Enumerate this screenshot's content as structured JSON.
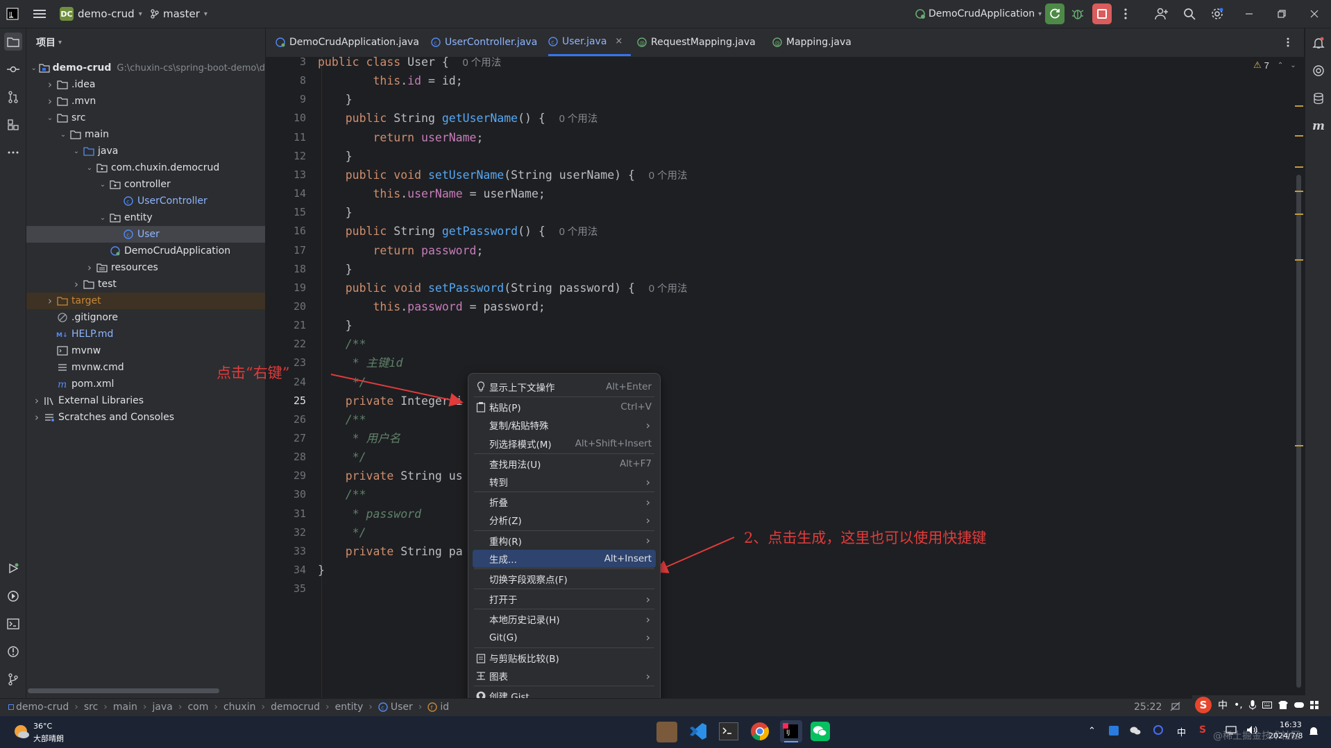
{
  "titlebar": {
    "app_badge": "DC",
    "project_name": "demo-crud",
    "branch": "master",
    "run_config": "DemoCrudApplication"
  },
  "project_panel": {
    "title": "项目",
    "tree": [
      {
        "label": "demo-crud",
        "path_hint": "G:\\chuxin-cs\\spring-boot-demo\\d",
        "icon": "module-icon",
        "arrow": "down",
        "depth": 0
      },
      {
        "label": ".idea",
        "icon": "folder-icon",
        "arrow": "right",
        "depth": 1
      },
      {
        "label": ".mvn",
        "icon": "folder-icon",
        "arrow": "right",
        "depth": 1
      },
      {
        "label": "src",
        "icon": "folder-icon",
        "arrow": "down",
        "depth": 1
      },
      {
        "label": "main",
        "icon": "folder-icon",
        "arrow": "down",
        "depth": 2
      },
      {
        "label": "java",
        "icon": "source-folder-icon",
        "arrow": "down",
        "depth": 3
      },
      {
        "label": "com.chuxin.democrud",
        "icon": "package-icon",
        "arrow": "down",
        "depth": 4
      },
      {
        "label": "controller",
        "icon": "package-icon",
        "arrow": "down",
        "depth": 5
      },
      {
        "label": "UserController",
        "icon": "class-icon",
        "arrow": "",
        "depth": 6
      },
      {
        "label": "entity",
        "icon": "package-icon",
        "arrow": "down",
        "depth": 5
      },
      {
        "label": "User",
        "icon": "class-icon",
        "arrow": "",
        "depth": 6
      },
      {
        "label": "DemoCrudApplication",
        "icon": "spring-class-icon",
        "arrow": "",
        "depth": 5
      },
      {
        "label": "resources",
        "icon": "resources-folder-icon",
        "arrow": "right",
        "depth": 4
      },
      {
        "label": "test",
        "icon": "folder-icon",
        "arrow": "right",
        "depth": 3
      },
      {
        "label": "target",
        "icon": "excluded-folder-icon",
        "arrow": "right",
        "depth": 1
      },
      {
        "label": ".gitignore",
        "icon": "gitignore-icon",
        "arrow": "",
        "depth": 1
      },
      {
        "label": "HELP.md",
        "icon": "markdown-icon",
        "arrow": "",
        "depth": 1
      },
      {
        "label": "mvnw",
        "icon": "terminal-file-icon",
        "arrow": "",
        "depth": 1
      },
      {
        "label": "mvnw.cmd",
        "icon": "text-file-icon",
        "arrow": "",
        "depth": 1
      },
      {
        "label": "pom.xml",
        "icon": "maven-icon",
        "arrow": "",
        "depth": 1
      },
      {
        "label": "External Libraries",
        "icon": "library-icon",
        "arrow": "right",
        "depth": 0
      },
      {
        "label": "Scratches and Consoles",
        "icon": "scratch-icon",
        "arrow": "right",
        "depth": 0
      }
    ]
  },
  "tabs": [
    {
      "label": "DemoCrudApplication.java",
      "icon": "spring-class-icon"
    },
    {
      "label": "UserController.java",
      "icon": "class-icon"
    },
    {
      "label": "User.java",
      "icon": "class-icon"
    },
    {
      "label": "RequestMapping.java",
      "icon": "annotation-icon"
    },
    {
      "label": "Mapping.java",
      "icon": "annotation-icon"
    }
  ],
  "editor": {
    "warning_count": "7",
    "line_numbers": [
      "3",
      "8",
      "9",
      "10",
      "11",
      "12",
      "13",
      "14",
      "15",
      "16",
      "17",
      "18",
      "19",
      "20",
      "21",
      "22",
      "23",
      "24",
      "25",
      "26",
      "27",
      "28",
      "29",
      "30",
      "31",
      "32",
      "33",
      "34",
      "35"
    ],
    "lines": [
      [
        {
          "t": "public class ",
          "c": "kw"
        },
        {
          "t": "User",
          "c": "cls"
        },
        {
          "t": " {  ",
          "c": ""
        },
        {
          "t": "0 个用法",
          "c": "hint"
        }
      ],
      [
        {
          "t": "        this",
          "c": "kw"
        },
        {
          "t": ".",
          "c": ""
        },
        {
          "t": "id",
          "c": "fld"
        },
        {
          "t": " = id;",
          "c": ""
        }
      ],
      [
        {
          "t": "    }",
          "c": ""
        }
      ],
      [
        {
          "t": "    public ",
          "c": "kw"
        },
        {
          "t": "String ",
          "c": ""
        },
        {
          "t": "getUserName",
          "c": "fn"
        },
        {
          "t": "() {  ",
          "c": ""
        },
        {
          "t": "0 个用法",
          "c": "hint"
        }
      ],
      [
        {
          "t": "        return ",
          "c": "kw"
        },
        {
          "t": "userName",
          "c": "fld"
        },
        {
          "t": ";",
          "c": ""
        }
      ],
      [
        {
          "t": "    }",
          "c": ""
        }
      ],
      [
        {
          "t": "    public void ",
          "c": "kw"
        },
        {
          "t": "setUserName",
          "c": "fn"
        },
        {
          "t": "(String userName) {  ",
          "c": ""
        },
        {
          "t": "0 个用法",
          "c": "hint"
        }
      ],
      [
        {
          "t": "        this",
          "c": "kw"
        },
        {
          "t": ".",
          "c": ""
        },
        {
          "t": "userName",
          "c": "fld"
        },
        {
          "t": " = userName;",
          "c": ""
        }
      ],
      [
        {
          "t": "    }",
          "c": ""
        }
      ],
      [
        {
          "t": "    public ",
          "c": "kw"
        },
        {
          "t": "String ",
          "c": ""
        },
        {
          "t": "getPassword",
          "c": "fn"
        },
        {
          "t": "() {  ",
          "c": ""
        },
        {
          "t": "0 个用法",
          "c": "hint"
        }
      ],
      [
        {
          "t": "        return ",
          "c": "kw"
        },
        {
          "t": "password",
          "c": "fld"
        },
        {
          "t": ";",
          "c": ""
        }
      ],
      [
        {
          "t": "    }",
          "c": ""
        }
      ],
      [
        {
          "t": "    public void ",
          "c": "kw"
        },
        {
          "t": "setPassword",
          "c": "fn"
        },
        {
          "t": "(String password) {  ",
          "c": ""
        },
        {
          "t": "0 个用法",
          "c": "hint"
        }
      ],
      [
        {
          "t": "        this",
          "c": "kw"
        },
        {
          "t": ".",
          "c": ""
        },
        {
          "t": "password",
          "c": "fld"
        },
        {
          "t": " = password;",
          "c": ""
        }
      ],
      [
        {
          "t": "    }",
          "c": ""
        }
      ],
      [
        {
          "t": "    /**",
          "c": "cm"
        }
      ],
      [
        {
          "t": "     * 主键id",
          "c": "cm"
        }
      ],
      [
        {
          "t": "     */",
          "c": "cm"
        }
      ],
      [
        {
          "t": "    private ",
          "c": "kw"
        },
        {
          "t": "Integer i",
          "c": ""
        }
      ],
      [
        {
          "t": "    /**",
          "c": "cm"
        }
      ],
      [
        {
          "t": "     * 用户名",
          "c": "cm"
        }
      ],
      [
        {
          "t": "     */",
          "c": "cm"
        }
      ],
      [
        {
          "t": "    private ",
          "c": "kw"
        },
        {
          "t": "String us",
          "c": ""
        }
      ],
      [
        {
          "t": "    /**",
          "c": "cm"
        }
      ],
      [
        {
          "t": "     * password",
          "c": "cm"
        }
      ],
      [
        {
          "t": "     */",
          "c": "cm"
        }
      ],
      [
        {
          "t": "    private ",
          "c": "kw"
        },
        {
          "t": "String pa",
          "c": ""
        }
      ],
      [
        {
          "t": "}",
          "c": ""
        }
      ],
      [
        {
          "t": "",
          "c": ""
        }
      ]
    ]
  },
  "context_menu": {
    "items": [
      {
        "label": "显示上下文操作",
        "shortcut": "Alt+Enter",
        "icon": "bulb-icon"
      },
      {
        "sep": true
      },
      {
        "label": "粘贴(P)",
        "shortcut": "Ctrl+V",
        "icon": "paste-icon"
      },
      {
        "label": "复制/粘贴特殊",
        "submenu": true
      },
      {
        "label": "列选择模式(M)",
        "shortcut": "Alt+Shift+Insert"
      },
      {
        "sep": true
      },
      {
        "label": "查找用法(U)",
        "shortcut": "Alt+F7"
      },
      {
        "label": "转到",
        "submenu": true
      },
      {
        "sep": true
      },
      {
        "label": "折叠",
        "submenu": true
      },
      {
        "label": "分析(Z)",
        "submenu": true
      },
      {
        "sep": true
      },
      {
        "label": "重构(R)",
        "submenu": true
      },
      {
        "label": "生成...",
        "shortcut": "Alt+Insert",
        "active": true
      },
      {
        "sep": true
      },
      {
        "label": "切换字段观察点(F)"
      },
      {
        "sep": true
      },
      {
        "label": "打开于",
        "submenu": true
      },
      {
        "sep": true
      },
      {
        "label": "本地历史记录(H)",
        "submenu": true
      },
      {
        "label": "Git(G)",
        "submenu": true
      },
      {
        "sep": true
      },
      {
        "label": "与剪贴板比较(B)",
        "icon": "compare-icon"
      },
      {
        "label": "图表",
        "submenu": true,
        "icon": "diagram-icon"
      },
      {
        "sep": true
      },
      {
        "label": "创建 Gist...",
        "icon": "github-icon"
      }
    ]
  },
  "annotations": {
    "right_click": "点击“右键”",
    "generate": "2、点击生成，这里也可以使用快捷键"
  },
  "statusbar": {
    "breadcrumbs": [
      "demo-crud",
      "src",
      "main",
      "java",
      "com",
      "chuxin",
      "democrud",
      "entity",
      "User",
      "id"
    ],
    "position": "25:22"
  },
  "taskbar": {
    "temperature": "36°C",
    "weather": "大部晴朗",
    "ime": "中",
    "time": "16:33",
    "date": "2024/7/8",
    "watermark": "@稀土掘金技术社区"
  },
  "colors": {
    "accent": "#3574f0",
    "keyword": "#cf8e6d",
    "method": "#56a8f5",
    "field": "#c77dbb",
    "comment": "#5f826b",
    "annotation_red": "#e23b3b"
  }
}
